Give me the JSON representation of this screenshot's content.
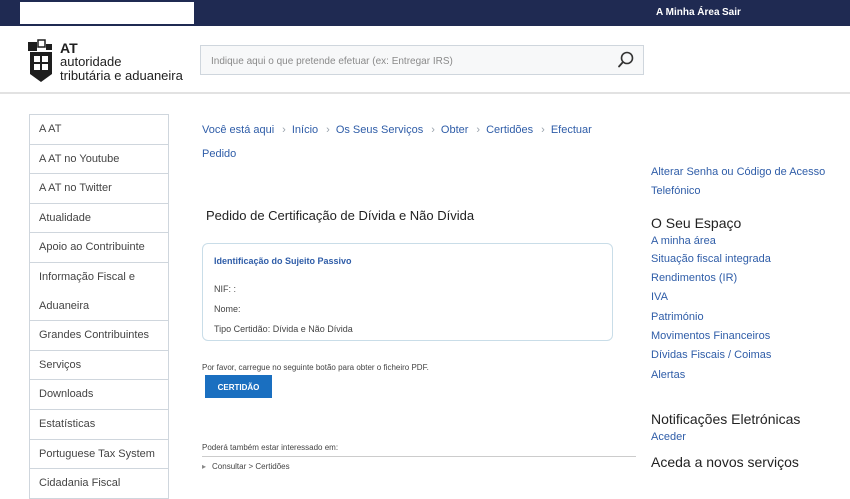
{
  "topbar": {
    "my_area": "A Minha Área",
    "logout": "Sair"
  },
  "logo": {
    "line1": "AT",
    "line2": "autoridade",
    "line3": "tributária e aduaneira"
  },
  "search": {
    "placeholder": "Indique aqui o que pretende efetuar (ex: Entregar IRS)",
    "value": ""
  },
  "sidebar": {
    "items": [
      {
        "label": "A AT"
      },
      {
        "label": "A AT no Youtube"
      },
      {
        "label": "A AT no Twitter"
      },
      {
        "label": "Atualidade"
      },
      {
        "label": "Apoio ao Contribuinte"
      },
      {
        "label": "Informação Fiscal e"
      },
      {
        "label": "Aduaneira"
      },
      {
        "label": "Grandes Contribuintes"
      },
      {
        "label": "Serviços"
      },
      {
        "label": "Downloads"
      },
      {
        "label": "Estatísticas"
      },
      {
        "label": "Portuguese Tax System"
      },
      {
        "label": "Cidadania Fiscal"
      }
    ]
  },
  "breadcrumb": {
    "prefix": "Você está aqui",
    "items": [
      "Início",
      "Os Seus Serviços",
      "Obter",
      "Certidões",
      "Efectuar",
      "Pedido"
    ]
  },
  "main": {
    "title": "Pedido de Certificação de Dívida e Não Dívida",
    "id_box": {
      "title": "Identificação do Sujeito Passivo",
      "nif": "NIF: :",
      "name": "Nome:",
      "cert_type": "Tipo Certidão: Dívida e Não Dívida"
    },
    "notice": "Por favor, carregue no seguinte botão para obter o ficheiro PDF.",
    "cert_button": "CERTIDÃO",
    "interest_heading": "Poderá também estar interessado em:",
    "interest_item": "Consultar > Certidões"
  },
  "right": {
    "link_password_1": "Alterar Senha ou Código de Acesso",
    "link_password_2": "Telefónico",
    "section_space": "O Seu Espaço",
    "space_links": [
      "A minha área",
      "Situação fiscal integrada",
      "Rendimentos (IR)",
      "IVA",
      "Património",
      "Movimentos Financeiros",
      "Dívidas Fiscais / Coimas",
      "Alertas"
    ],
    "section_notifications": "Notificações Eletrónicas",
    "notifications_link": "Aceder",
    "section_phone": "Aceda a novos serviços"
  }
}
